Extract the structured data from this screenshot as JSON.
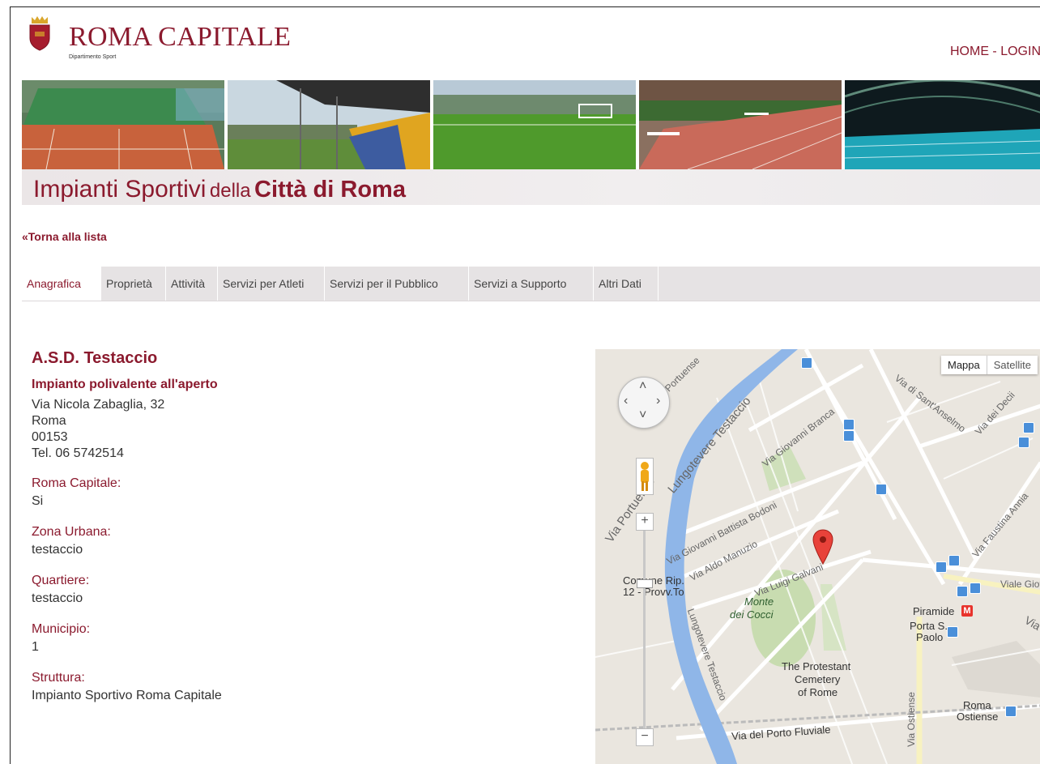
{
  "header": {
    "title": "ROMA CAPITALE",
    "subtitle": "Dipartimento Sport",
    "nav": {
      "home": "HOME",
      "separator": " - ",
      "login": "LOGIN"
    }
  },
  "banner": {
    "title_part1": "Impianti Sportivi",
    "title_part2": "della",
    "title_part3": "Città di Roma"
  },
  "back_link": "«Torna alla lista",
  "tabs": [
    {
      "label": "Anagrafica",
      "active": true
    },
    {
      "label": "Proprietà"
    },
    {
      "label": "Attività"
    },
    {
      "label": "Servizi per Atleti"
    },
    {
      "label": "Servizi per il Pubblico"
    },
    {
      "label": "Servizi a Supporto"
    },
    {
      "label": "Altri Dati"
    }
  ],
  "facility": {
    "name": "A.S.D. Testaccio",
    "type": "Impianto polivalente all'aperto",
    "address": "Via Nicola Zabaglia, 32",
    "city": "Roma",
    "cap": "00153",
    "phone": "Tel. 06 5742514"
  },
  "fields": [
    {
      "label": "Roma Capitale:",
      "value": "Si"
    },
    {
      "label": "Zona Urbana:",
      "value": "testaccio"
    },
    {
      "label": "Quartiere:",
      "value": "testaccio"
    },
    {
      "label": "Municipio:",
      "value": "1"
    },
    {
      "label": "Struttura:",
      "value": "Impianto Sportivo Roma Capitale"
    }
  ],
  "map": {
    "type_map": "Mappa",
    "type_satellite": "Satellite",
    "zoom_in": "+",
    "zoom_out": "−",
    "labels": {
      "portuense_top": "Portuense",
      "via_portuense": "Via Portuense",
      "lungotevere_testaccio": "Lungotevere Testaccio",
      "via_giovanni_branca": "Via Giovanni Branca",
      "via_sant_anselmo": "Via di Sant'Anselmo",
      "via_dei_decii": "Via dei Decii",
      "via_bodoni": "Via Giovanni Battista Bodoni",
      "via_manuzio": "Via Aldo Manuzio",
      "via_galvani": "Via Luigi Galvani",
      "via_faustina": "Via Faustina Annia",
      "viale_giotto": "Viale Giot",
      "comune_1": "Comune Rip.",
      "comune_2": "12 - Provv.To",
      "monte_1": "Monte",
      "monte_2": "dei Cocci",
      "lungotevere_testaccio_2": "Lungotevere Testaccio",
      "piramide": "Piramide",
      "porta_1": "Porta S.",
      "porta_2": "Paolo",
      "via_right": "Via",
      "cemetery_1": "The Protestant",
      "cemetery_2": "Cemetery",
      "cemetery_3": "of Rome",
      "via_ostiense": "Via Ostiense",
      "roma_ostiense_1": "Roma",
      "roma_ostiense_2": "Ostiense",
      "porto_fluviale": "Via del Porto Fluviale"
    },
    "metro_letter": "M"
  }
}
